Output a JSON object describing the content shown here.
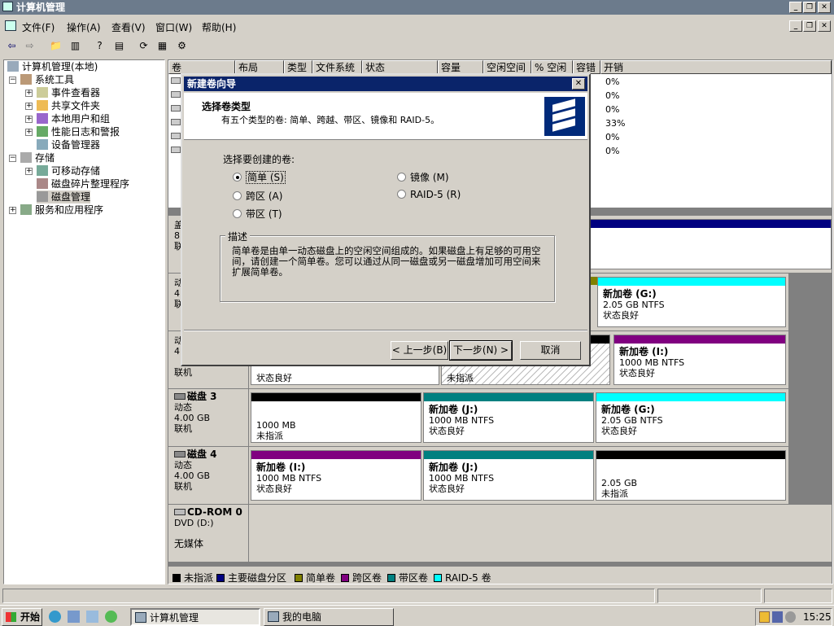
{
  "window": {
    "title": "计算机管理"
  },
  "menu": [
    "文件(F)",
    "操作(A)",
    "查看(V)",
    "窗口(W)",
    "帮助(H)"
  ],
  "tree": {
    "root": "计算机管理(本地)",
    "system_tools": "系统工具",
    "event_viewer": "事件查看器",
    "shared_folders": "共享文件夹",
    "local_users": "本地用户和组",
    "perf_logs": "性能日志和警报",
    "device_manager": "设备管理器",
    "storage": "存储",
    "removable": "可移动存储",
    "defrag": "磁盘碎片整理程序",
    "disk_mgmt": "磁盘管理",
    "services": "服务和应用程序"
  },
  "volume_list": {
    "columns": [
      "卷",
      "布局",
      "类型",
      "文件系统",
      "状态",
      "容量",
      "空闲空间",
      "% 空闲",
      "容错",
      "开销"
    ],
    "overhead": [
      "0%",
      "0%",
      "0%",
      "33%",
      "0%",
      "0%"
    ]
  },
  "disks": [
    {
      "name": "",
      "type": "",
      "size": "",
      "state": "",
      "peek": [
        "盖",
        "8",
        "联"
      ],
      "parts": [],
      "status_row": {
        "left": "",
        "right": ""
      }
    },
    {
      "name": "",
      "type": "",
      "size": "",
      "state": "",
      "peek": [
        "动",
        "4",
        "联"
      ],
      "parts": [
        {
          "title": "新加卷 (G:)",
          "line1": "2.05 GB NTFS",
          "line2": "状态良好"
        }
      ]
    },
    {
      "name": "",
      "type": "",
      "size": "",
      "state": "联机",
      "peek": [
        "动",
        "4"
      ],
      "parts": [
        {
          "title": "",
          "line1": "",
          "line2": "状态良好"
        },
        {
          "title": "",
          "line1": "",
          "line2": "未指派"
        },
        {
          "title": "新加卷 (I:)",
          "line1": "1000 MB NTFS",
          "line2": "状态良好"
        }
      ]
    },
    {
      "name": "磁盘 3",
      "type": "动态",
      "size": "4.00 GB",
      "state": "联机",
      "parts": [
        {
          "title": "",
          "line1": "1000 MB",
          "line2": "未指派"
        },
        {
          "title": "新加卷 (J:)",
          "line1": "1000 MB NTFS",
          "line2": "状态良好"
        },
        {
          "title": "新加卷 (G:)",
          "line1": "2.05 GB NTFS",
          "line2": "状态良好"
        }
      ]
    },
    {
      "name": "磁盘 4",
      "type": "动态",
      "size": "4.00 GB",
      "state": "联机",
      "parts": [
        {
          "title": "新加卷 (I:)",
          "line1": "1000 MB NTFS",
          "line2": "状态良好"
        },
        {
          "title": "新加卷 (J:)",
          "line1": "1000 MB NTFS",
          "line2": "状态良好"
        },
        {
          "title": "",
          "line1": "2.05 GB",
          "line2": "未指派"
        }
      ]
    },
    {
      "name": "CD-ROM 0",
      "type": "DVD (D:)",
      "size": "",
      "state": "无媒体",
      "parts": []
    }
  ],
  "legend": [
    {
      "label": "未指派",
      "color": "#000000"
    },
    {
      "label": "主要磁盘分区",
      "color": "#000080"
    },
    {
      "label": "简单卷",
      "color": "#808000"
    },
    {
      "label": "跨区卷",
      "color": "#800080"
    },
    {
      "label": "带区卷",
      "color": "#008080"
    },
    {
      "label": "RAID-5 卷",
      "color": "#00ffff"
    }
  ],
  "dialog": {
    "title": "新建卷向导",
    "heading": "选择卷类型",
    "subheading": "有五个类型的卷: 简单、跨越、带区、镜像和 RAID-5。",
    "prompt": "选择要创建的卷:",
    "options": {
      "simple": "简单 (S)",
      "spanned": "跨区 (A)",
      "striped": "带区 (T)",
      "mirrored": "镜像 (M)",
      "raid5": "RAID-5 (R)"
    },
    "description_label": "描述",
    "description": "简单卷是由单一动态磁盘上的空闲空间组成的。如果磁盘上有足够的可用空间，请创建一个简单卷。您可以通过从同一磁盘或另一磁盘增加可用空间来扩展简单卷。",
    "back": "< 上一步(B)",
    "next": "下一步(N) >",
    "cancel": "取消"
  },
  "taskbar": {
    "start": "开始",
    "tasks": [
      "计算机管理",
      "我的电脑"
    ],
    "clock": "15:25"
  }
}
